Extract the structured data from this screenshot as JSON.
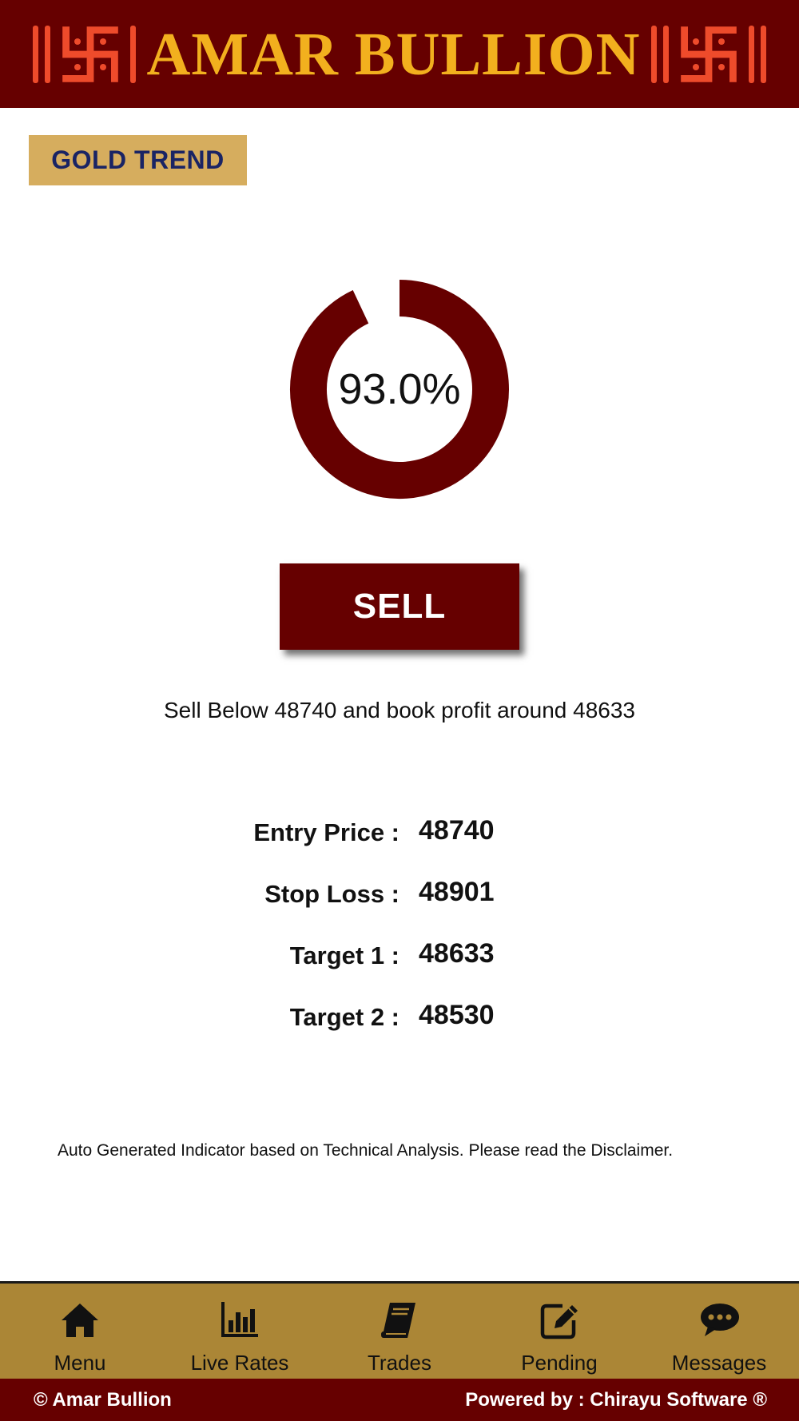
{
  "header": {
    "brand_title": "AMAR BULLION"
  },
  "section": {
    "title": "GOLD TREND"
  },
  "gauge": {
    "value_label": "93.0%",
    "percent": 93.0,
    "color": "#660000"
  },
  "signal": {
    "action_label": "SELL",
    "advice_text": "Sell Below 48740 and book profit around 48633"
  },
  "levels": [
    {
      "label": "Entry Price :",
      "value": "48740"
    },
    {
      "label": "Stop Loss :",
      "value": "48901"
    },
    {
      "label": "Target 1 :",
      "value": "48633"
    },
    {
      "label": "Target 2 :",
      "value": "48530"
    }
  ],
  "disclaimer": "Auto Generated Indicator based on Technical Analysis. Please read the Disclaimer.",
  "tabbar": {
    "items": [
      {
        "label": "Menu",
        "icon": "home-icon"
      },
      {
        "label": "Live Rates",
        "icon": "bar-chart-icon"
      },
      {
        "label": "Trades",
        "icon": "book-icon"
      },
      {
        "label": "Pending",
        "icon": "edit-icon"
      },
      {
        "label": "Messages",
        "icon": "chat-bubble-icon"
      }
    ]
  },
  "footer": {
    "copyright": "© Amar Bullion",
    "powered_by": "Powered by : Chirayu Software ®"
  },
  "colors": {
    "header_bg": "#660000",
    "brand_gold": "#f2b01e",
    "symbol_red": "#ee4b2b",
    "badge_bg": "#d6ad5e",
    "badge_text": "#1a2464",
    "tabbar_bg": "#ab8636"
  }
}
